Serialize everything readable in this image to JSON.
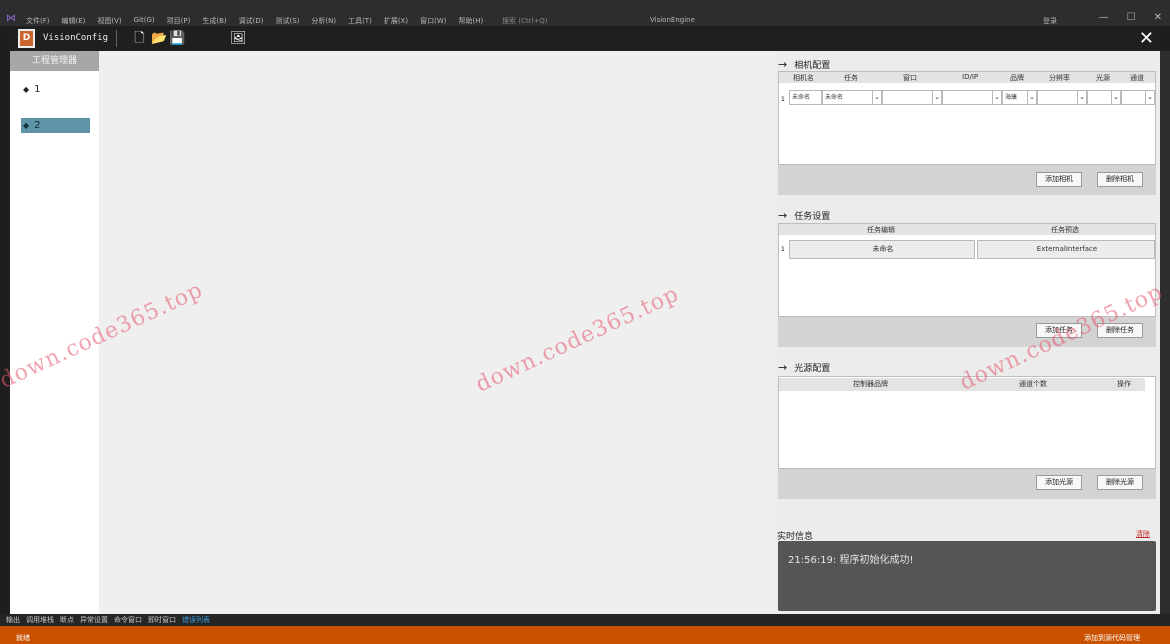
{
  "vs_window": {
    "menu": [
      "文件(F)",
      "编辑(E)",
      "视图(V)",
      "Git(G)",
      "项目(P)",
      "生成(B)",
      "调试(D)",
      "测试(S)",
      "分析(N)",
      "工具(T)",
      "扩展(X)",
      "窗口(W)",
      "帮助(H)"
    ],
    "search": "搜索 (Ctrl+Q)",
    "solution_title": "VisionEngine",
    "login": "登录",
    "bottom_tabs": [
      "输出",
      "调用堆栈",
      "断点",
      "异常设置",
      "命令窗口",
      "即时窗口",
      "错误列表"
    ],
    "status_ready": "就绪",
    "status_right": "添加到源代码管理"
  },
  "app": {
    "name": "VisionConfig",
    "logo_letter": "D"
  },
  "project_panel": {
    "header": "工程管理器",
    "items": [
      "1",
      "2"
    ]
  },
  "camera_section": {
    "title": "相机配置",
    "columns": [
      "相机名",
      "任务",
      "窗口",
      "ID/IP",
      "品牌",
      "分辨率",
      "光源",
      "通道"
    ],
    "row": {
      "index": "1",
      "name": "未命名",
      "task": "未命名",
      "brand": "海康"
    },
    "add_button": "添加相机",
    "delete_button": "删除相机"
  },
  "task_section": {
    "title": "任务设置",
    "columns": [
      "任务编辑",
      "任务预选"
    ],
    "row": {
      "index": "1",
      "name": "未命名",
      "preset": "ExternalInterface"
    },
    "add_button": "添加任务",
    "delete_button": "删除任务"
  },
  "light_section": {
    "title": "光源配置",
    "columns": [
      "控制器品牌",
      "通道个数",
      "操作"
    ],
    "add_button": "添加光源",
    "delete_button": "删除光源"
  },
  "info_section": {
    "title": "实时信息",
    "clear": "清除",
    "message": "21:56:19: 程序初始化成功!"
  },
  "watermark": "down.code365.top"
}
